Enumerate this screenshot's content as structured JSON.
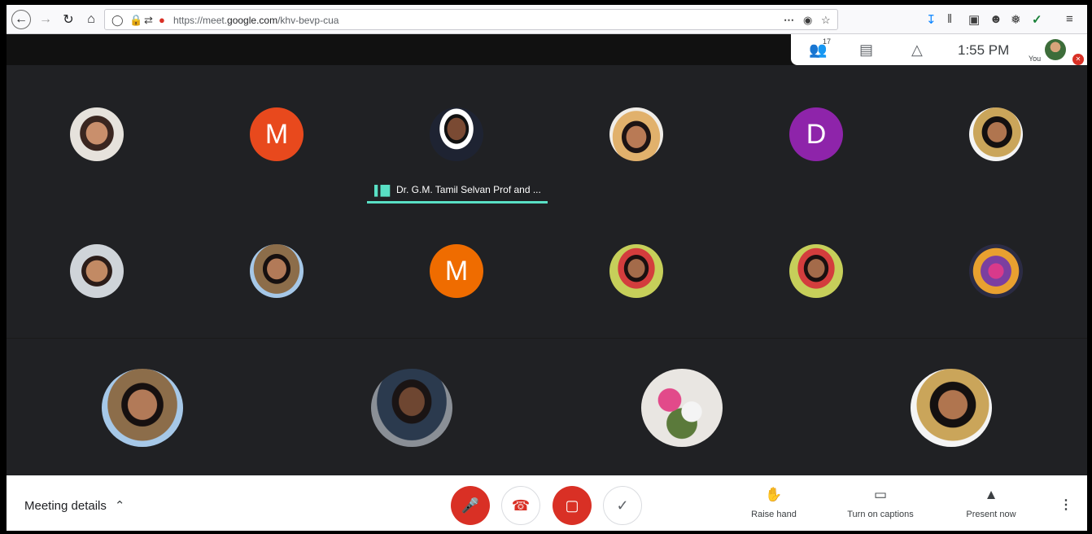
{
  "browser": {
    "url_prefix": "https://meet.",
    "url_domain": "google.com",
    "url_path": "/khv-bevp-cua",
    "icons": [
      "back-icon",
      "forward-icon",
      "reload-icon",
      "home-icon",
      "shield-icon",
      "lock-icon",
      "permissions-icon",
      "mic-indicator-icon",
      "more-icon",
      "pocket-icon",
      "star-icon",
      "download-icon",
      "library-icon",
      "sidebar-icon",
      "account-icon",
      "extension-icon",
      "check-extension-icon",
      "menu-icon"
    ]
  },
  "meet_header": {
    "participants_count": "17",
    "time": "1:55 PM",
    "you_label": "You"
  },
  "tiles": [
    {
      "kind": "photo",
      "letter": ""
    },
    {
      "kind": "letter",
      "letter": "M",
      "color": "#e8491d"
    },
    {
      "kind": "photo",
      "letter": ""
    },
    {
      "kind": "photo",
      "letter": ""
    },
    {
      "kind": "letter",
      "letter": "D",
      "color": "#8e24aa"
    },
    {
      "kind": "photo",
      "letter": ""
    },
    {
      "kind": "photo",
      "letter": ""
    },
    {
      "kind": "photo",
      "letter": ""
    },
    {
      "kind": "letter",
      "letter": "M",
      "color": "#ef6c00"
    },
    {
      "kind": "photo",
      "letter": ""
    },
    {
      "kind": "photo",
      "letter": ""
    },
    {
      "kind": "photo",
      "letter": ""
    },
    {
      "kind": "photo",
      "letter": ""
    },
    {
      "kind": "photo",
      "letter": ""
    },
    {
      "kind": "photo",
      "letter": ""
    },
    {
      "kind": "photo",
      "letter": ""
    }
  ],
  "active_speaker": {
    "name": "Dr. G.M. Tamil Selvan Prof and ..."
  },
  "controls": {
    "meeting_details": "Meeting details",
    "raise_hand": "Raise hand",
    "captions": "Turn on captions",
    "present": "Present now"
  },
  "colors": {
    "accent_teal": "#59e0c5",
    "danger_red": "#d93025",
    "grid_bg": "#202124"
  }
}
